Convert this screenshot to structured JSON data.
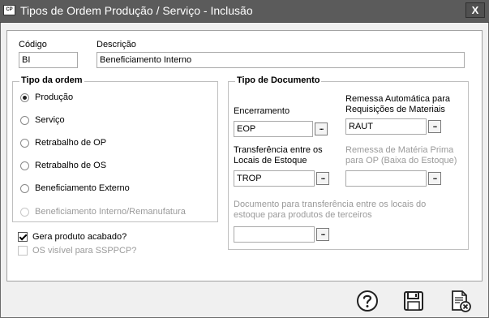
{
  "window": {
    "title": "Tipos de Ordem Produção / Serviço - Inclusão",
    "icon_text": "CP",
    "close_label": "X"
  },
  "codigo": {
    "label": "Código",
    "value": "BI"
  },
  "descricao": {
    "label": "Descrição",
    "value": "Beneficiamento Interno"
  },
  "tipo_ordem": {
    "title": "Tipo da ordem",
    "options": [
      {
        "label": "Produção",
        "checked": true,
        "enabled": true
      },
      {
        "label": "Serviço",
        "checked": false,
        "enabled": true
      },
      {
        "label": "Retrabalho de OP",
        "checked": false,
        "enabled": true
      },
      {
        "label": "Retrabalho de OS",
        "checked": false,
        "enabled": true
      },
      {
        "label": "Beneficiamento Externo",
        "checked": false,
        "enabled": true
      },
      {
        "label": "Beneficiamento Interno/Remanufatura",
        "checked": false,
        "enabled": false
      }
    ]
  },
  "gera_produto": {
    "label": "Gera produto acabado?",
    "checked": true
  },
  "os_visivel": {
    "label": "OS visível para SSPPCP?",
    "checked": false
  },
  "tipo_documento": {
    "title": "Tipo de Documento",
    "encerramento": {
      "label": "Encerramento",
      "value": "EOP"
    },
    "remessa_auto": {
      "label_line1": "Remessa Automática para",
      "label_line2": "Requisições de Materiais",
      "value": "RAUT"
    },
    "transferencia": {
      "label_line1": "Transferência entre os",
      "label_line2": "Locais de Estoque",
      "value": "TROP"
    },
    "remessa_materia": {
      "label_line1": "Remessa de Matéria Prima",
      "label_line2": "para OP (Baixa do Estoque)",
      "value": ""
    },
    "doc_terceiros": {
      "label_line1": "Documento para transferência entre os locais do",
      "label_line2": "estoque para produtos de terceiros",
      "value": ""
    },
    "lookup_button_label": "..."
  },
  "toolbar": {
    "help_icon": "help-icon",
    "save_icon": "save-icon",
    "cancel_icon": "cancel-document-icon"
  }
}
